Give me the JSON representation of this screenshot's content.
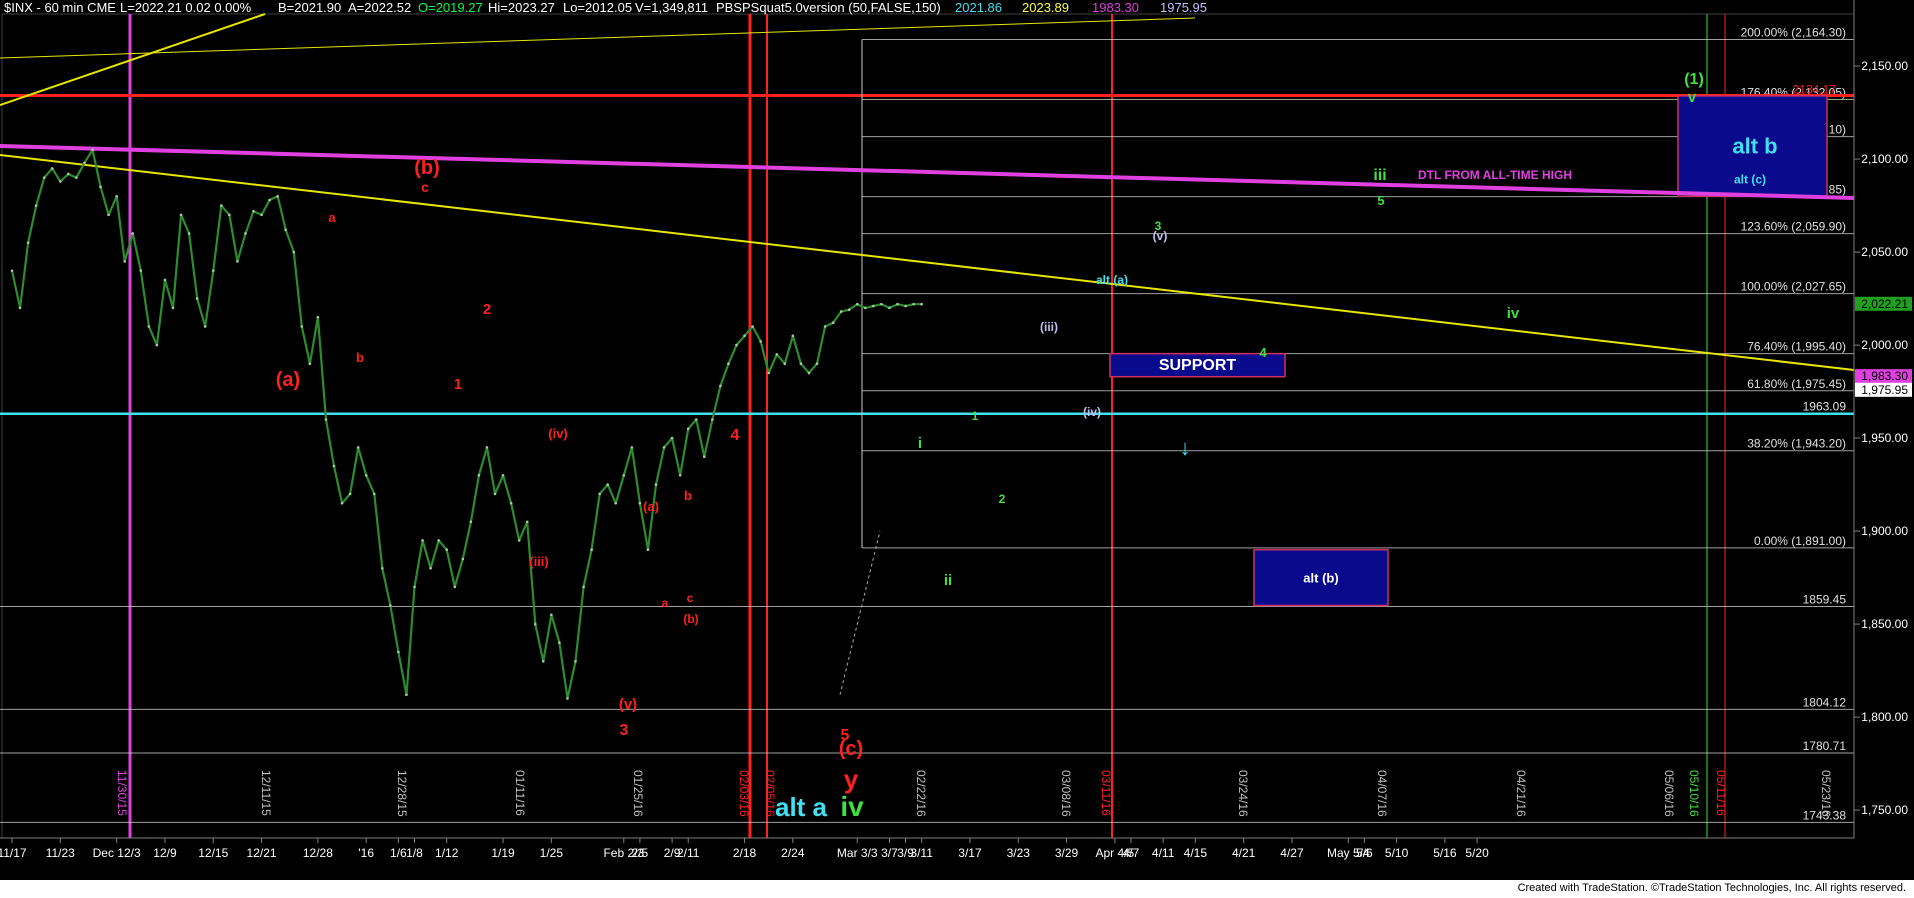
{
  "header": {
    "symbol": "$INX - 60 min  CME",
    "last": "L=2022.21  0.02    0.00%",
    "bid": "B=2021.90",
    "ask": "A=2022.52",
    "open": "O=2019.27",
    "high": "Hi=2023.27",
    "low": "Lo=2012.05",
    "volume": "V=1,349,811",
    "study": "PBSPSquat5.0version (50,FALSE,150)",
    "study_v1": "2021.86",
    "study_v2": "2023.89",
    "study_v3": "1983.30",
    "study_v4": "1975.95"
  },
  "footer": {
    "credit": "Created with TradeStation. ©TradeStation Technologies, Inc. All rights reserved."
  },
  "colors": {
    "background": "#000000",
    "price": "#2e8b2e",
    "trend_yellow": "#e6e600",
    "magenta": "#e040e0",
    "red": "#ff2020",
    "cyan": "#40e0f0",
    "fib_white": "#c8c8c8",
    "box_fill": "#0a0a8c",
    "green_label": "#40e040"
  },
  "chart_data": {
    "type": "line",
    "title": "",
    "ylim": [
      1735,
      2178
    ],
    "y_axis_ticks": [
      "2,150.00",
      "2,100.00",
      "2,050.00",
      "2,000.00",
      "1,950.00",
      "1,900.00",
      "1,850.00",
      "1,800.00",
      "1,750.00"
    ],
    "y_axis_tick_values": [
      2150,
      2100,
      2050,
      2000,
      1950,
      1900,
      1850,
      1800,
      1750
    ],
    "x_axis_ticks": [
      "11/17",
      "11/23",
      "Dec 12/3",
      "12/9",
      "12/15",
      "12/21",
      "12/28",
      "'16",
      "1/6",
      "1/8",
      "1/12",
      "1/19",
      "1/25",
      "Feb 2/3",
      "2/5",
      "2/9",
      "2/11",
      "2/18",
      "2/24",
      "Mar 3/3",
      "3/7",
      "3/9",
      "3/11",
      "3/17",
      "3/23",
      "3/29",
      "Apr 4/5",
      "4/7",
      "4/11",
      "4/15",
      "4/21",
      "4/27",
      "May 5/4",
      "5/6",
      "5/10",
      "5/16",
      "5/20"
    ],
    "x_tick_bar_index": [
      0,
      6,
      13,
      19,
      25,
      31,
      38,
      44,
      48,
      50,
      54,
      61,
      67,
      76,
      78,
      82,
      84,
      91,
      97,
      105,
      109,
      111,
      113,
      119,
      125,
      131,
      137,
      139,
      143,
      147,
      153,
      159,
      166,
      168,
      172,
      178,
      182
    ],
    "price_series": {
      "name": "$INX",
      "bar_index": [
        0,
        1,
        2,
        3,
        4,
        5,
        6,
        7,
        8,
        9,
        10,
        11,
        12,
        13,
        14,
        15,
        16,
        17,
        18,
        19,
        20,
        21,
        22,
        23,
        24,
        25,
        26,
        27,
        28,
        29,
        30,
        31,
        32,
        33,
        34,
        35,
        36,
        37,
        38,
        39,
        40,
        41,
        42,
        43,
        44,
        45,
        46,
        47,
        48,
        49,
        50,
        51,
        52,
        53,
        54,
        55,
        56,
        57,
        58,
        59,
        60,
        61,
        62,
        63,
        64,
        65,
        66,
        67,
        68,
        69,
        70,
        71,
        72,
        73,
        74,
        75,
        76,
        77,
        78,
        79,
        80,
        81,
        82,
        83,
        84,
        85,
        86,
        87,
        88,
        89,
        90,
        91,
        92,
        93,
        94,
        95,
        96,
        97,
        98,
        99,
        100,
        101,
        102,
        103,
        104,
        105,
        106,
        107,
        108,
        109,
        110,
        111,
        112,
        113
      ],
      "values": [
        2040,
        2020,
        2055,
        2075,
        2090,
        2095,
        2088,
        2092,
        2090,
        2098,
        2105,
        2085,
        2070,
        2080,
        2045,
        2060,
        2040,
        2010,
        2000,
        2035,
        2020,
        2070,
        2060,
        2025,
        2010,
        2040,
        2075,
        2070,
        2045,
        2060,
        2072,
        2070,
        2078,
        2080,
        2062,
        2050,
        2010,
        1990,
        2015,
        1960,
        1935,
        1915,
        1920,
        1945,
        1930,
        1920,
        1880,
        1860,
        1835,
        1812,
        1870,
        1895,
        1880,
        1895,
        1890,
        1870,
        1885,
        1905,
        1930,
        1945,
        1920,
        1930,
        1915,
        1895,
        1905,
        1850,
        1830,
        1855,
        1840,
        1810,
        1830,
        1870,
        1890,
        1920,
        1925,
        1915,
        1930,
        1945,
        1915,
        1890,
        1925,
        1945,
        1950,
        1930,
        1955,
        1960,
        1940,
        1960,
        1978,
        1990,
        2000,
        2005,
        2010,
        2002,
        1985,
        1995,
        1990,
        2005,
        1990,
        1985,
        1990,
        2010,
        2012,
        2018,
        2019,
        2022,
        2020,
        2021,
        2022,
        2020,
        2022,
        2021,
        2022,
        2022
      ]
    },
    "horizontal_levels": [
      {
        "label": "200.00% (2,164.30)",
        "value": 2164.3
      },
      {
        "label": "176.40% (2,132.05)",
        "value": 2132.05
      },
      {
        "label": "161.80% (2,112.10)",
        "value": 2112.1
      },
      {
        "label": "138.20% (2,079.85)",
        "value": 2079.85
      },
      {
        "label": "123.60% (2,059.90)",
        "value": 2059.9
      },
      {
        "label": "100.00% (2,027.65)",
        "value": 2027.65
      },
      {
        "label": "76.40% (1,995.40)",
        "value": 1995.4
      },
      {
        "label": "61.80% (1,975.45)",
        "value": 1975.45
      },
      {
        "label": "38.20% (1,943.20)",
        "value": 1943.2
      },
      {
        "label": "0.00% (1,891.00)",
        "value": 1891.0
      },
      {
        "label": "1859.45",
        "value": 1859.45
      },
      {
        "label": "1804.12",
        "value": 1804.12
      },
      {
        "label": "1780.71",
        "value": 1780.71
      },
      {
        "label": "1743.38",
        "value": 1743.38
      },
      {
        "label": "1963.09",
        "value": 1963.09
      }
    ],
    "price_tags": [
      {
        "label": "2134.17",
        "value": 2134.17
      },
      {
        "label": "2,022.21",
        "value": 2022.21
      },
      {
        "label": "1,983.30",
        "value": 1983.3
      },
      {
        "label": "1,975.95",
        "value": 1975.95
      }
    ],
    "date_markers": [
      "11/30/15",
      "12/11/15",
      "12/28/15",
      "01/11/16",
      "01/25/16",
      "02/03/16",
      "02/05/16",
      "02/22/16",
      "03/08/16",
      "03/11/16",
      "03/24/16",
      "04/07/16",
      "04/21/16",
      "05/06/16",
      "05/10/16",
      "05/11/16",
      "05/23/16"
    ],
    "boxes": [
      "SUPPORT",
      "alt (b)",
      "alt b",
      "alt (c)"
    ],
    "annotations": {
      "wave_labels_red": [
        "(a)",
        "(b)",
        "c",
        "a",
        "b",
        "1",
        "2",
        "(iv)",
        "(iii)",
        "(v)",
        "3",
        "(a)",
        "b",
        "a",
        "c",
        "(b)",
        "4",
        "5",
        "(c)",
        "y"
      ],
      "wave_labels_other": [
        "alt a",
        "iv",
        "i",
        "ii",
        "1",
        "2",
        "(iii)",
        "(iv)",
        "(v)",
        "3",
        "alt (a)",
        "iii",
        "5",
        "4",
        "iv",
        "(1)",
        "v",
        "DTL FROM ALL-TIME HIGH"
      ]
    }
  }
}
